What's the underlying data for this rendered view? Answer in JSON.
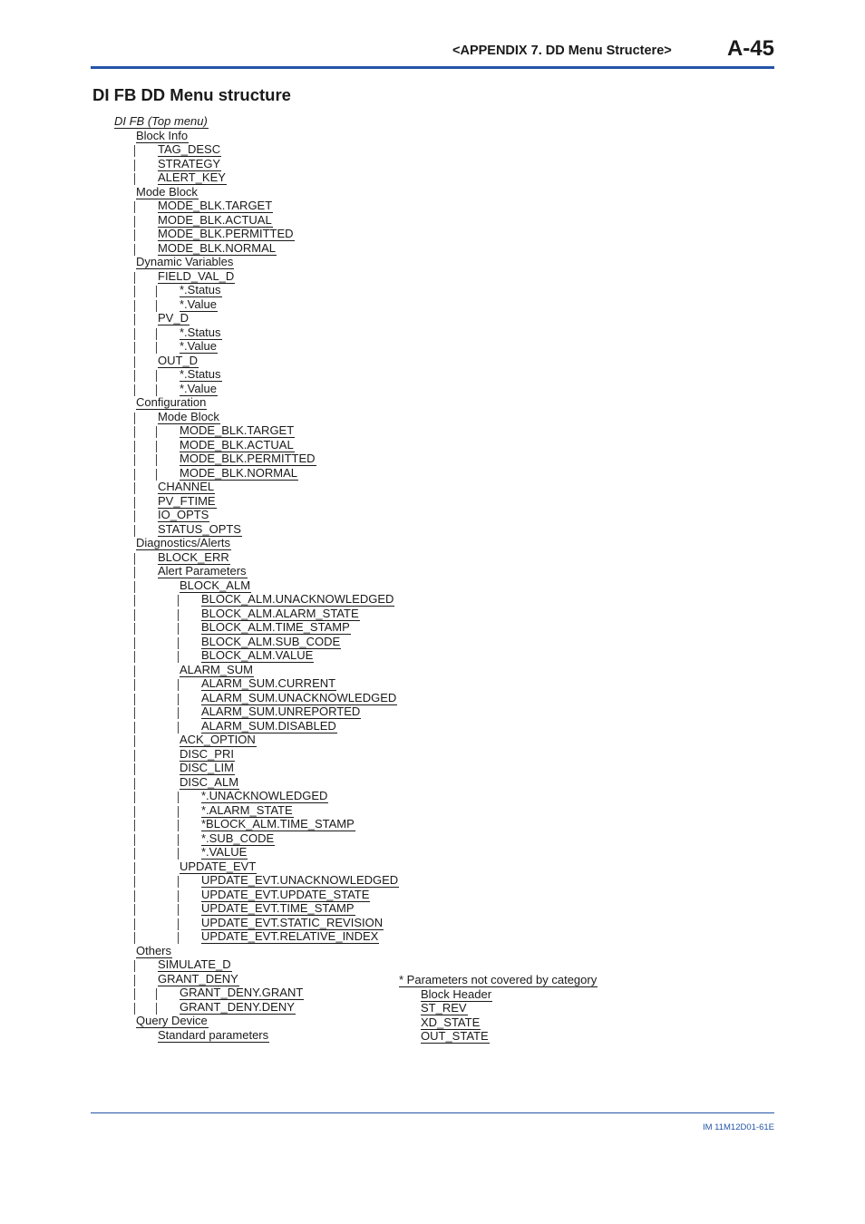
{
  "header": {
    "title": "<APPENDIX 7. DD Menu Structere>",
    "page_number": "A-45",
    "rule_color": "#2454a6"
  },
  "section_title": "DI FB DD Menu structure",
  "tree": [
    {
      "level": 0,
      "label": "DI FB (Top menu)",
      "italic": true,
      "bars": []
    },
    {
      "level": 1,
      "label": "Block Info",
      "bars": []
    },
    {
      "level": 2,
      "label": "TAG_DESC",
      "bars": [
        1
      ]
    },
    {
      "level": 2,
      "label": "STRATEGY",
      "bars": [
        1
      ]
    },
    {
      "level": 2,
      "label": "ALERT_KEY",
      "bars": [
        1
      ]
    },
    {
      "level": 1,
      "label": "Mode Block",
      "bars": []
    },
    {
      "level": 2,
      "label": "MODE_BLK.TARGET",
      "bars": [
        1
      ]
    },
    {
      "level": 2,
      "label": "MODE_BLK.ACTUAL",
      "bars": [
        1
      ]
    },
    {
      "level": 2,
      "label": "MODE_BLK.PERMITTED",
      "bars": [
        1
      ]
    },
    {
      "level": 2,
      "label": "MODE_BLK.NORMAL",
      "bars": [
        1
      ]
    },
    {
      "level": 1,
      "label": "Dynamic Variables",
      "bars": []
    },
    {
      "level": 2,
      "label": "FIELD_VAL_D",
      "bars": [
        1
      ]
    },
    {
      "level": 3,
      "label": "*.Status",
      "bars": [
        1,
        2
      ]
    },
    {
      "level": 3,
      "label": "*.Value",
      "bars": [
        1,
        2
      ]
    },
    {
      "level": 2,
      "label": "PV_D",
      "bars": [
        1
      ]
    },
    {
      "level": 3,
      "label": "*.Status",
      "bars": [
        1,
        2
      ]
    },
    {
      "level": 3,
      "label": "*.Value",
      "bars": [
        1,
        2
      ]
    },
    {
      "level": 2,
      "label": "OUT_D",
      "bars": [
        1
      ]
    },
    {
      "level": 3,
      "label": "*.Status",
      "bars": [
        1,
        2
      ]
    },
    {
      "level": 3,
      "label": "*.Value",
      "bars": [
        1,
        2
      ]
    },
    {
      "level": 1,
      "label": "Configuration",
      "bars": []
    },
    {
      "level": 2,
      "label": "Mode Block",
      "bars": [
        1
      ]
    },
    {
      "level": 3,
      "label": "MODE_BLK.TARGET",
      "bars": [
        1,
        2
      ]
    },
    {
      "level": 3,
      "label": "MODE_BLK.ACTUAL",
      "bars": [
        1,
        2
      ]
    },
    {
      "level": 3,
      "label": "MODE_BLK.PERMITTED",
      "bars": [
        1,
        2
      ]
    },
    {
      "level": 3,
      "label": "MODE_BLK.NORMAL",
      "bars": [
        1,
        2
      ]
    },
    {
      "level": 2,
      "label": "CHANNEL",
      "bars": [
        1
      ]
    },
    {
      "level": 2,
      "label": "PV_FTIME",
      "bars": [
        1
      ]
    },
    {
      "level": 2,
      "label": "IO_OPTS",
      "bars": [
        1
      ]
    },
    {
      "level": 2,
      "label": "STATUS_OPTS",
      "bars": [
        1
      ]
    },
    {
      "level": 1,
      "label": "Diagnostics/Alerts",
      "bars": []
    },
    {
      "level": 2,
      "label": "BLOCK_ERR",
      "bars": [
        1
      ]
    },
    {
      "level": 2,
      "label": "Alert Parameters",
      "bars": [
        1
      ]
    },
    {
      "level": 3,
      "label": "BLOCK_ALM",
      "bars": [
        1
      ]
    },
    {
      "level": 4,
      "label": "BLOCK_ALM.UNACKNOWLEDGED",
      "bars": [
        1,
        3
      ]
    },
    {
      "level": 4,
      "label": "BLOCK_ALM.ALARM_STATE",
      "bars": [
        1,
        3
      ]
    },
    {
      "level": 4,
      "label": "BLOCK_ALM.TIME_STAMP",
      "bars": [
        1,
        3
      ]
    },
    {
      "level": 4,
      "label": "BLOCK_ALM.SUB_CODE",
      "bars": [
        1,
        3
      ]
    },
    {
      "level": 4,
      "label": "BLOCK_ALM.VALUE",
      "bars": [
        1,
        3
      ]
    },
    {
      "level": 3,
      "label": "ALARM_SUM",
      "bars": [
        1
      ]
    },
    {
      "level": 4,
      "label": "ALARM_SUM.CURRENT",
      "bars": [
        1,
        3
      ]
    },
    {
      "level": 4,
      "label": "ALARM_SUM.UNACKNOWLEDGED",
      "bars": [
        1,
        3
      ]
    },
    {
      "level": 4,
      "label": "ALARM_SUM.UNREPORTED",
      "bars": [
        1,
        3
      ]
    },
    {
      "level": 4,
      "label": "ALARM_SUM.DISABLED",
      "bars": [
        1,
        3
      ]
    },
    {
      "level": 3,
      "label": "ACK_OPTION",
      "bars": [
        1
      ]
    },
    {
      "level": 3,
      "label": "DISC_PRI",
      "bars": [
        1
      ]
    },
    {
      "level": 3,
      "label": "DISC_LIM",
      "bars": [
        1
      ]
    },
    {
      "level": 3,
      "label": "DISC_ALM",
      "bars": [
        1
      ]
    },
    {
      "level": 4,
      "label": "*.UNACKNOWLEDGED",
      "bars": [
        1,
        3
      ]
    },
    {
      "level": 4,
      "label": "*.ALARM_STATE",
      "bars": [
        1,
        3
      ]
    },
    {
      "level": 4,
      "label": "*BLOCK_ALM.TIME_STAMP",
      "bars": [
        1,
        3
      ]
    },
    {
      "level": 4,
      "label": "*.SUB_CODE",
      "bars": [
        1,
        3
      ]
    },
    {
      "level": 4,
      "label": "*.VALUE",
      "bars": [
        1,
        3
      ]
    },
    {
      "level": 3,
      "label": "UPDATE_EVT",
      "bars": [
        1
      ]
    },
    {
      "level": 4,
      "label": "UPDATE_EVT.UNACKNOWLEDGED",
      "bars": [
        1,
        3
      ]
    },
    {
      "level": 4,
      "label": "UPDATE_EVT.UPDATE_STATE",
      "bars": [
        1,
        3
      ]
    },
    {
      "level": 4,
      "label": "UPDATE_EVT.TIME_STAMP",
      "bars": [
        1,
        3
      ]
    },
    {
      "level": 4,
      "label": "UPDATE_EVT.STATIC_REVISION",
      "bars": [
        1,
        3
      ]
    },
    {
      "level": 4,
      "label": "UPDATE_EVT.RELATIVE_INDEX",
      "bars": [
        1,
        3
      ]
    },
    {
      "level": 1,
      "label": "Others",
      "bars": []
    },
    {
      "level": 2,
      "label": "SIMULATE_D",
      "bars": [
        1
      ]
    },
    {
      "level": 2,
      "label": "GRANT_DENY",
      "bars": [
        1
      ]
    },
    {
      "level": 3,
      "label": "GRANT_DENY.GRANT",
      "bars": [
        1,
        2
      ]
    },
    {
      "level": 3,
      "label": "GRANT_DENY.DENY",
      "bars": [
        1,
        2
      ]
    },
    {
      "level": 1,
      "label": "Query Device",
      "bars": []
    },
    {
      "level": 2,
      "label": "Standard parameters ",
      "bars": []
    }
  ],
  "side_list": [
    {
      "level": 0,
      "label": "* Parameters not covered by category"
    },
    {
      "level": 1,
      "label": "Block Header"
    },
    {
      "level": 1,
      "label": "ST_REV"
    },
    {
      "level": 1,
      "label": "XD_STATE"
    },
    {
      "level": 1,
      "label": "OUT_STATE"
    }
  ],
  "footer": {
    "doc_id": "IM 11M12D01-61E"
  }
}
